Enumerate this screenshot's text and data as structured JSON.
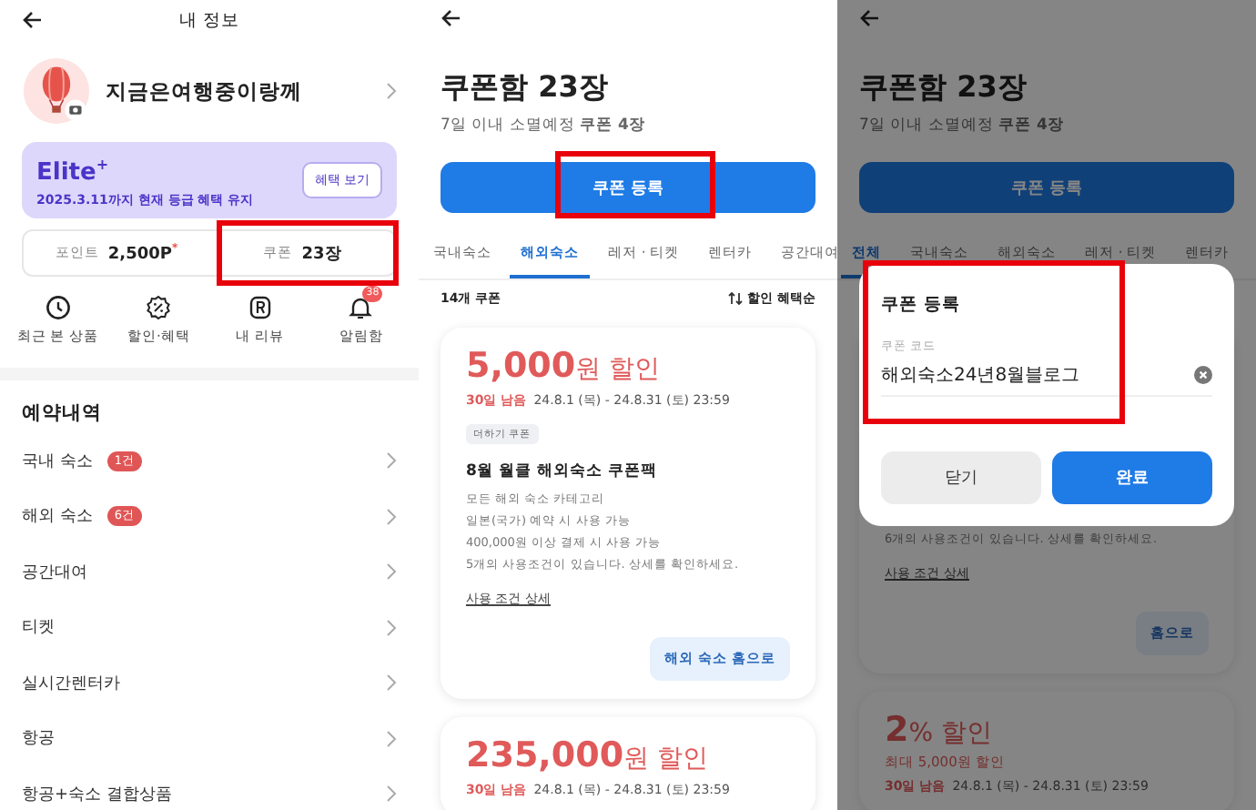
{
  "my_info": {
    "title": "내 정보",
    "profile": {
      "name": "지금은여행중이랑께"
    },
    "membership": {
      "grade": "Elite$^{+}$",
      "period": "2025.3.11까지 현재 등급 혜택 유지",
      "button": "혜택 보기"
    },
    "stats": [
      {
        "label": "포인트",
        "value": "2,500P$^{*}$",
        "highlighted": false
      },
      {
        "label": "쿠폰",
        "value": "23장",
        "highlighted": true
      }
    ],
    "shortcuts": [
      {
        "kind": "clock",
        "label": "최근 본 상품"
      },
      {
        "kind": "discount",
        "label": "할인·혜택"
      },
      {
        "kind": "review",
        "label": "내 리뷰"
      },
      {
        "kind": "bell",
        "label": "알림함",
        "badge": "38"
      }
    ],
    "reservations": {
      "title": "예약내역",
      "items": [
        {
          "label": "국내 숙소",
          "badge": "1건"
        },
        {
          "label": "해외 숙소",
          "badge": "6건"
        },
        {
          "label": "공간대여"
        },
        {
          "label": "티켓"
        },
        {
          "label": "실시간렌터카"
        },
        {
          "label": "항공"
        },
        {
          "label": "항공+숙소 결합상품"
        }
      ]
    }
  },
  "coupon_box": {
    "title": "쿠폰함 23장",
    "subtitle": "7일 이내 소멸예정 **쿠폰 4장**",
    "register_button": {
      "label": "쿠폰 등록",
      "highlighted": true
    },
    "tabs": [
      {
        "label": "국내숙소",
        "selected": false
      },
      {
        "label": "해외숙소",
        "selected": true
      },
      {
        "label": "레저 · 티켓",
        "selected": false
      },
      {
        "label": "렌터카",
        "selected": false
      },
      {
        "label": "공간대여",
        "selected": false
      }
    ],
    "count": "14개 쿠폰",
    "sort": "할인 혜택순",
    "coupons": [
      {
        "amount": "5,000",
        "suffix": "원 할인",
        "remaining": "30일 남음",
        "period": "24.8.1 (목) - 24.8.31 (토) 23:59",
        "tag": "더하기 쿠폰",
        "name": "8월 월클 해외숙소 쿠폰팩",
        "lines": [
          "모든 해외 숙소 카테고리",
          "일본(국가) 예약 시 사용 가능",
          "400,000원 이상 결제 시 사용 가능",
          "5개의 사용조건이 있습니다. 상세를 확인하세요."
        ],
        "link": "사용 조건 상세",
        "button": "해외 숙소 홈으로"
      },
      {
        "amount": "235,000",
        "suffix": "원 할인",
        "remaining": "30일 남음",
        "period": "24.8.1 (목) - 24.8.31 (토) 23:59"
      }
    ]
  },
  "coupon_register": {
    "title": "쿠폰함 23장",
    "subtitle": "7일 이내 소멸예정 **쿠폰 4장**",
    "register_button": {
      "label": "쿠폰 등록",
      "highlighted": false
    },
    "tabs": [
      {
        "label": "전체",
        "selected": true
      },
      {
        "label": "국내숙소",
        "selected": false
      },
      {
        "label": "해외숙소",
        "selected": false
      },
      {
        "label": "레저 · 티켓",
        "selected": false
      },
      {
        "label": "렌터카",
        "selected": false
      }
    ],
    "coupons": [
      {
        "lines": [
          "6개의 사용조건이 있습니다. 상세를 확인하세요."
        ],
        "link": "사용 조건 상세",
        "button": "홈으로"
      },
      {
        "amount": "2",
        "suffix": "% 할인",
        "max": "최대 5,000원 할인",
        "remaining": "30일 남음",
        "period": "24.8.1 (목) - 24.8.31 (토) 23:59"
      }
    ],
    "dialog": {
      "title": "쿠폰 등록",
      "field_label": "쿠폰 코드",
      "value": "해외숙소24년8월블로그",
      "highlighted": true,
      "buttons": [
        {
          "label": "닫기",
          "primary": false
        },
        {
          "label": "완료",
          "primary": true
        }
      ]
    }
  }
}
